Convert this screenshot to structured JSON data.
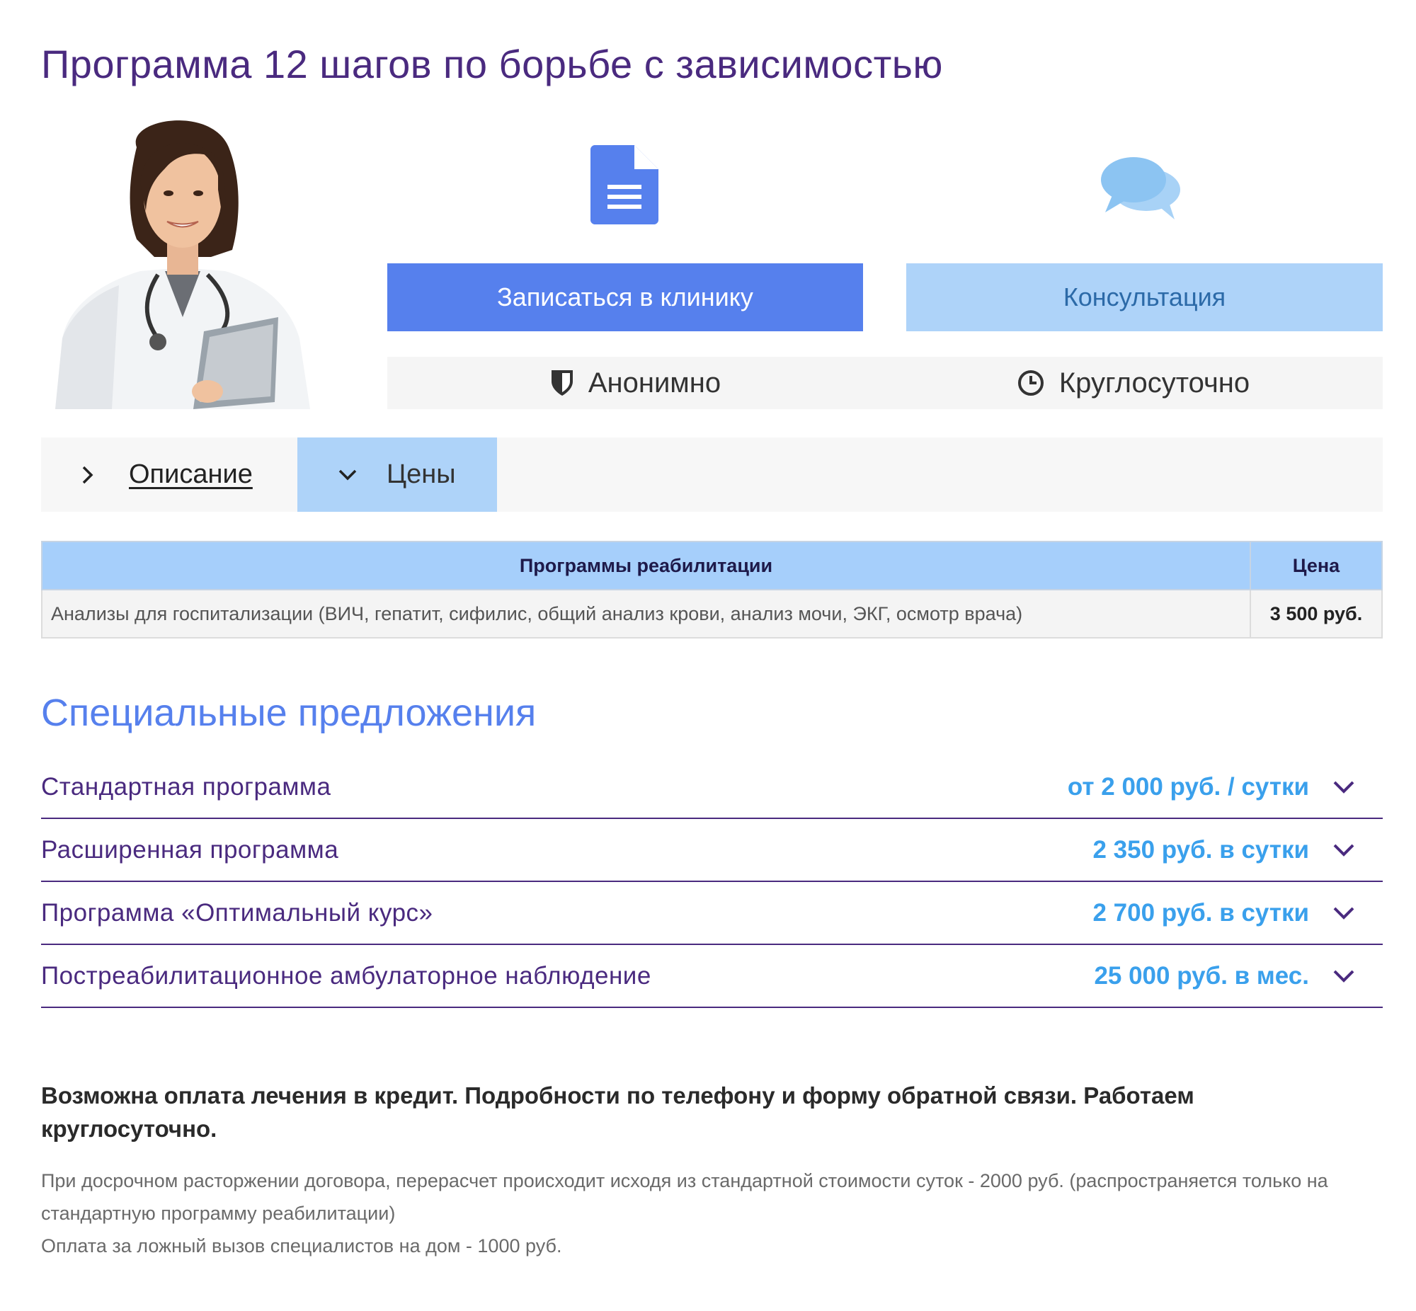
{
  "page_title": "Программа 12 шагов по борьбе с зависимостью",
  "icons": {
    "document": "document-icon",
    "chat": "chat-bubbles-icon",
    "shield": "shield-icon",
    "clock": "clock-icon",
    "chevron_right": "chevron-right-icon",
    "chevron_down": "chevron-down-icon"
  },
  "buttons": {
    "signup": "Записаться в клинику",
    "consult": "Консультация"
  },
  "features": {
    "anonymous": "Анонимно",
    "around_clock": "Круглосуточно"
  },
  "tabs": {
    "description": "Описание",
    "prices": "Цены"
  },
  "price_table": {
    "headers": [
      "Программы реабилитации",
      "Цена"
    ],
    "rows": [
      {
        "name": "Анализы для госпитализации (ВИЧ, гепатит, сифилис, общий анализ крови, анализ мочи, ЭКГ, осмотр врача)",
        "price": "3 500 руб."
      }
    ]
  },
  "special_title": "Специальные предложения",
  "offers": [
    {
      "name": "Стандартная программа",
      "price": "от 2 000 руб. / сутки"
    },
    {
      "name": "Расширенная программа",
      "price": "2 350 руб. в сутки"
    },
    {
      "name": "Программа «Оптимальный курс»",
      "price": "2 700 руб. в сутки"
    },
    {
      "name": "Постреабилитационное амбулаторное наблюдение",
      "price": "25 000 руб. в мес."
    }
  ],
  "credit_note": "Возможна оплата лечения в кредит. Подробности по телефону и форму обратной связи. Работаем круглосуточно.",
  "notes": [
    "При досрочном расторжении договора, перерасчет происходит исходя из стандартной стоимости суток - 2000 руб. (распространяется только на стандартную программу реабилитации)",
    "Оплата за ложный вызов специалистов на дом - 1000 руб."
  ],
  "colors": {
    "title": "#4a2a7f",
    "primary_button": "#5680ed",
    "secondary_button": "#aed3f9",
    "offer_price": "#3aa0ec"
  }
}
